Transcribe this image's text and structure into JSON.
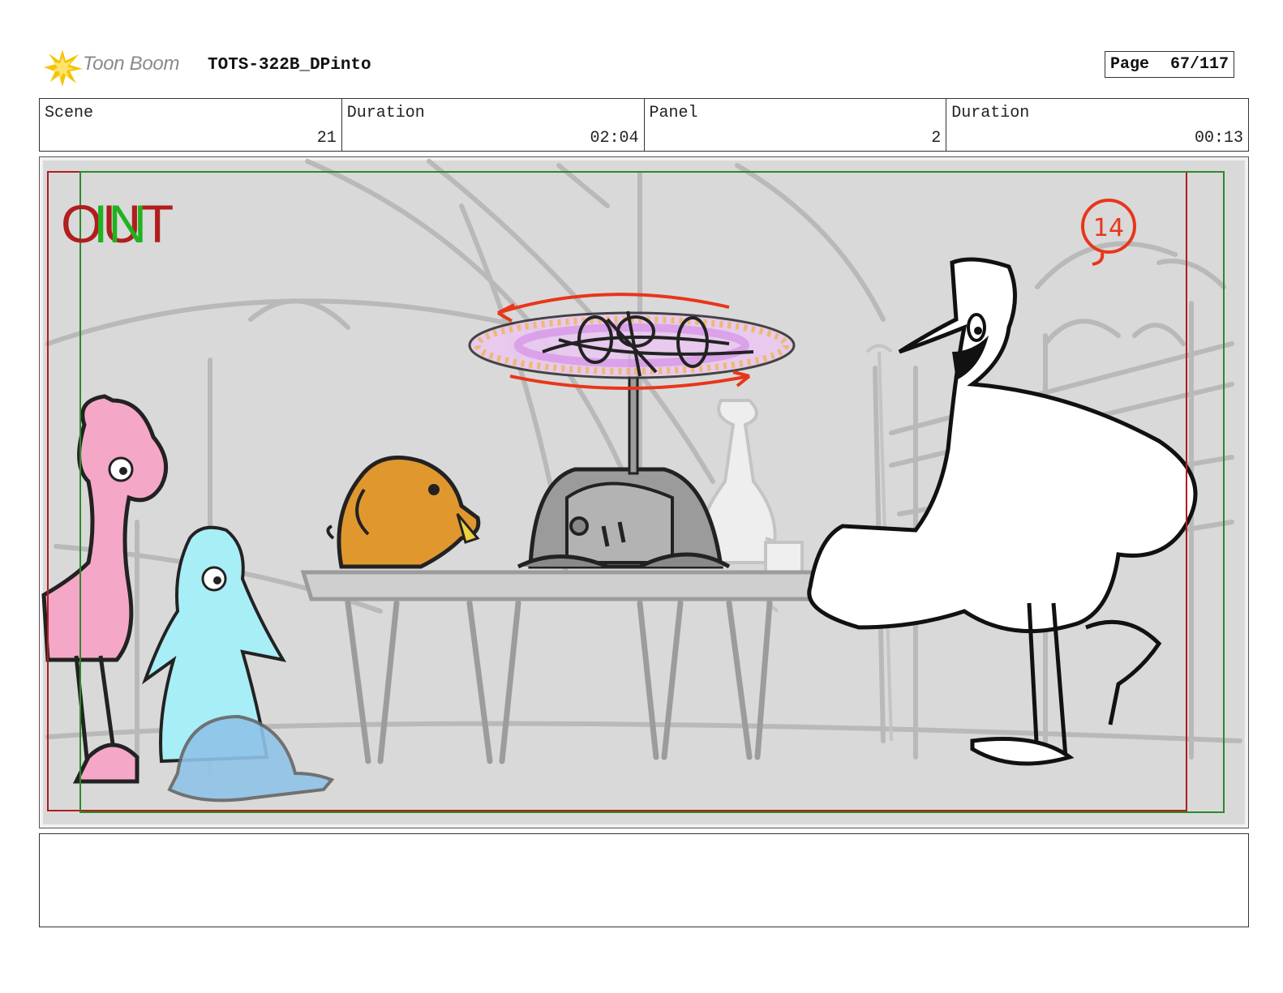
{
  "header": {
    "brand": "Toon Boom",
    "project_title": "TOTS-322B_DPinto",
    "page_label": "Page",
    "page_number": "67/117"
  },
  "info": {
    "scene_label": "Scene",
    "scene_value": "21",
    "scene_duration_label": "Duration",
    "scene_duration_value": "02:04",
    "panel_label": "Panel",
    "panel_value": "2",
    "panel_duration_label": "Duration",
    "panel_duration_value": "00:13"
  },
  "panel": {
    "in_text": "IN",
    "out_text": "OUT",
    "shot_number": "14"
  },
  "notes": {
    "text": ""
  },
  "colors": {
    "safe_frame_red": "#b01e1e",
    "safe_frame_green": "#2a8a2a",
    "shot_marker": "#e8361a"
  }
}
